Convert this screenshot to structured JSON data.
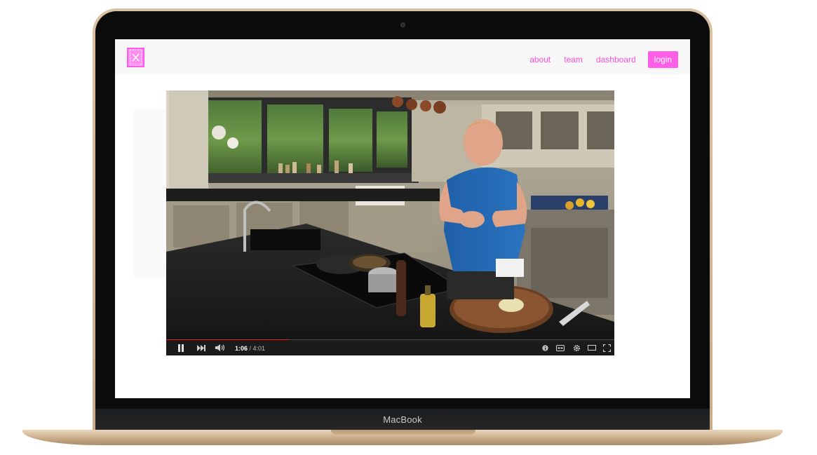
{
  "device": {
    "label": "MacBook"
  },
  "nav": {
    "links": [
      "about",
      "team",
      "dashboard"
    ],
    "login_label": "login"
  },
  "video": {
    "current_time": "1:06",
    "separator": " / ",
    "duration": "4:01",
    "progress_fraction": 0.274
  },
  "icons": {
    "logo": "fork-knife-book-logo",
    "pause": "pause-icon",
    "next": "next-icon",
    "volume": "volume-icon",
    "info": "info-icon",
    "captions": "captions-icon",
    "settings": "gear-icon",
    "theater": "theater-mode-icon",
    "fullscreen": "fullscreen-icon"
  },
  "colors": {
    "brand": "#ff5fe8",
    "progress": "#e62117"
  }
}
